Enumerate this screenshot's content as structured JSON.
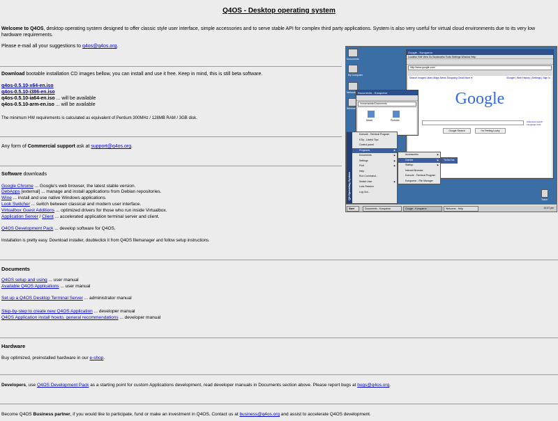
{
  "page_title": "Q4OS - Desktop operating system",
  "intro": {
    "welcome_strong": "Welcome to Q4OS",
    "welcome_text": ", desktop operating system designed to offer classic style user interface, simple accessories and to serve stable API for complex third party applications. System is also very useful for virtual cloud environments due to its very low",
    "welcome_text2": "hardware requirements.",
    "email_prefix": "Please e-mail all your suggestions to ",
    "email": "q4os@q4os.org",
    "email_suffix": "."
  },
  "download": {
    "strong": "Download",
    "text": " bootable installation CD images bellow, you can install and use it free. Keep in mind, this is still beta software.",
    "isos": [
      {
        "name": "q4os-0.5.10-x64-en.iso",
        "note": ""
      },
      {
        "name": "q4os-0.5.10-i386-en.iso",
        "note": ""
      },
      {
        "name": "q4os-0.5.10-ia64-en.iso",
        "note": " ... will be available"
      },
      {
        "name": "q4os-0.5.10-arm-en.iso",
        "note": " ... will be available"
      }
    ],
    "requirements": "The minimum HW requirements is calculated as equivalent of Pentium 300MHz / 128MB RAM / 3GB disk."
  },
  "support": {
    "prefix": "Any form of ",
    "strong": "Commercial support",
    "middle": " ask at ",
    "email": "support@q4os.org",
    "suffix": "."
  },
  "software": {
    "strong": "Software",
    "text": " downloads",
    "items": [
      {
        "link": "Google Chrome",
        "desc": " ... Google's web browser, the latest stable version."
      },
      {
        "link": "DebApps",
        "desc": " [external] ... manage and install applications from Debian repositories."
      },
      {
        "link": "Wine",
        "desc": " ... install and use native Windows applications."
      },
      {
        "link": "Look Switcher",
        "desc": " ... switch between classical and modern user interface."
      },
      {
        "link": "Virtualbox Guest Additions",
        "desc": " ... optimized drivers for those who run inside Virtualbox."
      }
    ],
    "appserver_link1": "Application Server",
    "appserver_sep": " / ",
    "appserver_link2": "Client",
    "appserver_desc": " ... accelerated application terminal server and client.",
    "devpack_link": "Q4OS Development Pack",
    "devpack_desc": " ... develop software for Q4OS.",
    "install_note": "Installation is pretty easy. Download installer, doubleclick it from Q4OS filemanager and follow setup instructions."
  },
  "documents": {
    "heading": "Documents",
    "items": [
      {
        "link": "Q4OS setup and using",
        "desc": " ... user manual"
      },
      {
        "link": "Available Q4OS Applications",
        "desc": " ... user manual"
      },
      {
        "link": "Set up a Q4OS Desktop Terminal Server",
        "desc": " ... administrator manual"
      },
      {
        "link": "Step-by-step to create new Q4OS Application",
        "desc": " ... developer manual"
      },
      {
        "link": "Q4OS Application install howto, general recommendations",
        "desc": " ... developer manual"
      }
    ]
  },
  "hardware": {
    "heading": "Hardware",
    "prefix": "Buy optimized, preinstalled hardware in our ",
    "link": "e-shop",
    "suffix": "."
  },
  "developers": {
    "strong": "Developers",
    "text1": ", use ",
    "link": "Q4OS Development Pack",
    "text2": " as a starting point for custom Applications development, read developer manuals in Documents section above. Please report bugs at ",
    "email": "bugs@q4os.org",
    "suffix": "."
  },
  "partner": {
    "prefix": "Become Q4OS ",
    "strong": "Business partner",
    "text": ", if you would like to participate, fund or make an investment in Q4OS. Contact us at ",
    "email": "business@q4os.org",
    "suffix": " and assist to accelerate Q4OS development."
  },
  "screenshot": {
    "desktop_icons": [
      "Documents",
      "My Computer",
      "Network Neigh.",
      "Windows Browser"
    ],
    "browser_title": "Google - Konqueror",
    "browser_menu": "Location  Edit  View  Go  Bookmarks  Tools  Settings  Window  Help",
    "browser_location": "http://www.google.com/",
    "google_nav": "Search  Images  Video  Maps  News  Shopping  Gmail  More ▾",
    "google_logo": "Google",
    "google_btn1": "Google Search",
    "google_btn2": "I'm Feeling Lucky",
    "google_adv": "Advanced search",
    "google_lang": "Language tools",
    "google_toplinks": "iGoogle | Web History | Settings | Sign in",
    "docs_title": "Documents - Konqueror",
    "docs_location": "/home/admin/Documents",
    "docs_items": [
      "Music",
      "Pictures"
    ],
    "side_label": "Q4 Operating System",
    "start_menu": [
      "Konsole - Terminal Program",
      "KTip - Useful Tips",
      "Control panel",
      "Programs",
      "Documents",
      "Settings",
      "Find",
      "Help",
      "Run Command...",
      "Switch User",
      "Lock Session",
      "Log Out..."
    ],
    "programs_menu": [
      "Accessories",
      "Games",
      "Startup",
      "Internet Browser",
      "Konsole - Terminal Program",
      "Konqueror - File Manager"
    ],
    "games_menu": [
      "TicTacToe"
    ],
    "taskbar_start": "Start",
    "taskbar_items": [
      "Documents - Konqueror",
      "Google - Konqueror",
      "Welcome - Help"
    ],
    "clock": "10:47 pm",
    "trash_label": "Trash"
  }
}
